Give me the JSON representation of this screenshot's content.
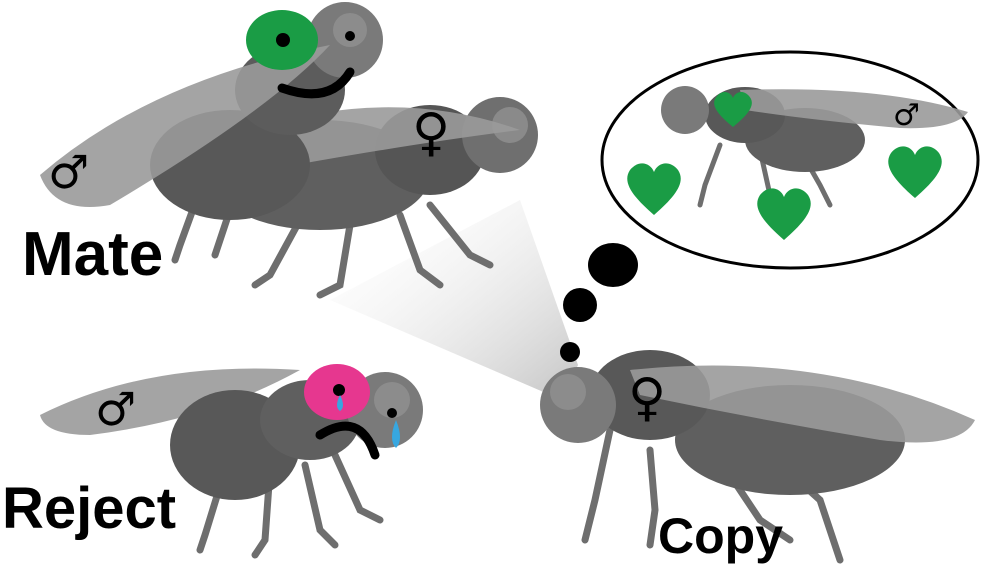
{
  "labels": {
    "mate": "Mate",
    "reject": "Reject",
    "copy": "Copy"
  },
  "symbols": {
    "male": "♂",
    "female": "♀"
  },
  "colors": {
    "background": "#ffffff",
    "fly_body": "#5f5f5f",
    "fly_body_light": "#8a8a8a",
    "fly_wing": "#9a9a9a",
    "fly_leg": "#6e6e6e",
    "eye_mated_male": "#1a9c45",
    "eye_rejected_male": "#e6378f",
    "heart": "#1a9c45",
    "tear": "#37a7e0",
    "text": "#000000"
  },
  "icons": [
    "heart-icon",
    "tear-icon",
    "male-symbol",
    "female-symbol",
    "thought-bubble"
  ]
}
